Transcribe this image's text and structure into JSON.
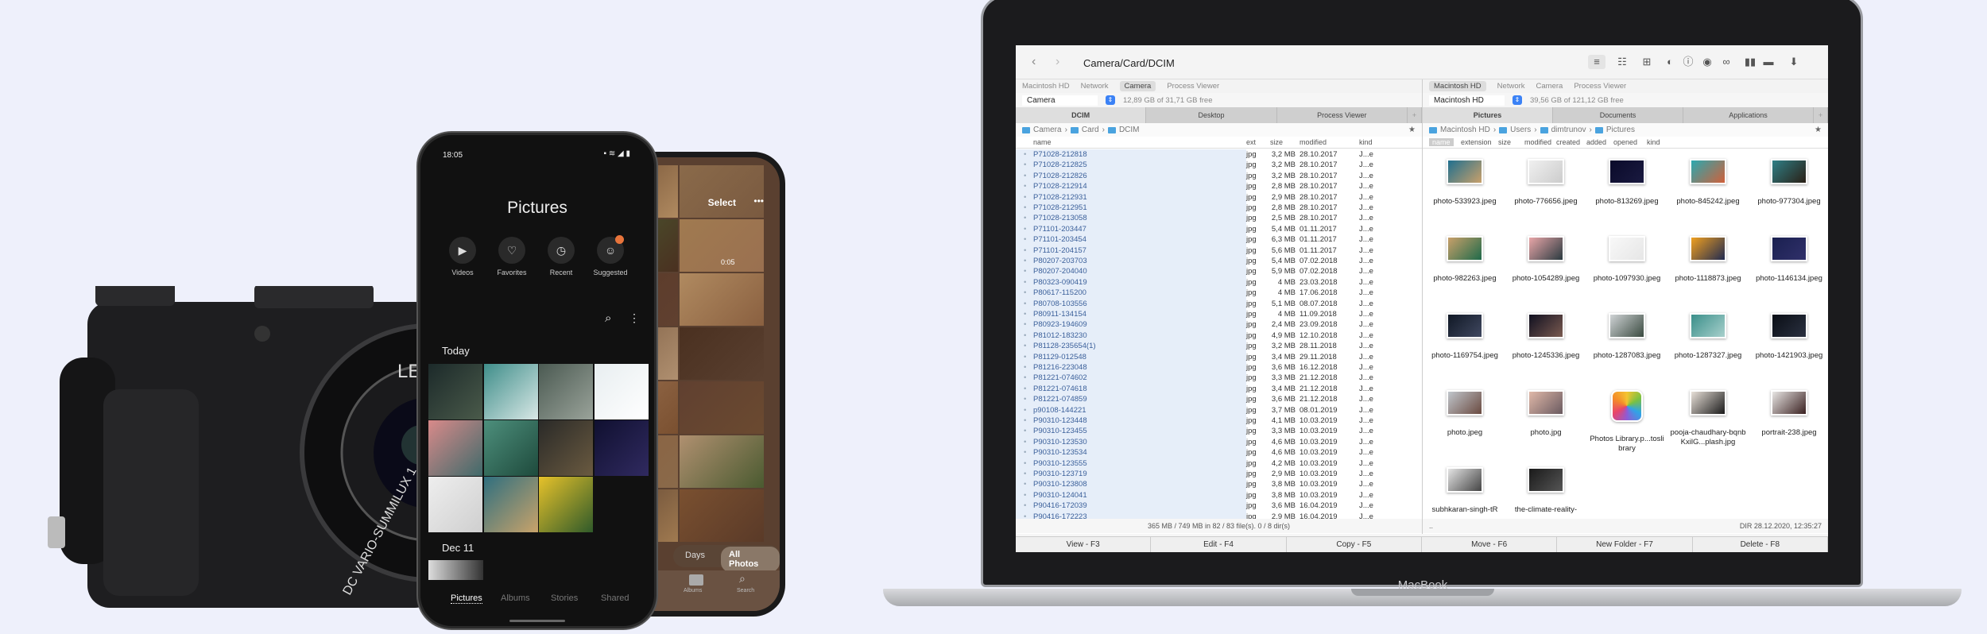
{
  "camera": {
    "brand_text": "LEI",
    "lens_text": "DC VARIO-SUMMILUX 1"
  },
  "android": {
    "time": "18:05",
    "title": "Pictures",
    "quick": [
      {
        "label": "Videos",
        "icon": "video-icon",
        "glyph": "▶"
      },
      {
        "label": "Favorites",
        "icon": "heart-icon",
        "glyph": "♡"
      },
      {
        "label": "Recent",
        "icon": "clock-icon",
        "glyph": "◷"
      },
      {
        "label": "Suggested",
        "icon": "suggested-icon",
        "glyph": "☺"
      }
    ],
    "section_today": "Today",
    "section_dec": "Dec 11",
    "thumb_colors": [
      [
        "#1c2a2a",
        "#4a5a4a"
      ],
      [
        "#3f8e8a",
        "#d9e8e6"
      ],
      [
        "#4b5a52",
        "#9aa39a"
      ],
      [
        "#e8eef0",
        "#ffffff"
      ],
      [
        "#d98a8a",
        "#3f6a6a"
      ],
      [
        "#4d8f7c",
        "#1e4a3c"
      ],
      [
        "#2a2a28",
        "#6a5a40"
      ],
      [
        "#101030",
        "#302a60"
      ],
      [
        "#eeeeee",
        "#cfcfcf"
      ],
      [
        "#2f6f7f",
        "#c9a36a"
      ],
      [
        "#e7c22a",
        "#2f5a2a"
      ]
    ],
    "nav": [
      {
        "label": "Pictures",
        "active": true
      },
      {
        "label": "Albums"
      },
      {
        "label": "Stories"
      },
      {
        "label": "Shared"
      }
    ]
  },
  "iphone": {
    "select": "Select",
    "more": "•••",
    "video_duration": "0:05",
    "days": "Days",
    "all_photos": "All Photos",
    "albums": "Albums",
    "search": "Search"
  },
  "laptop": {
    "brand": "MacBook"
  },
  "fm": {
    "path": "Camera/Card/DCIM",
    "locations": [
      "Macintosh HD",
      "Network",
      "Camera",
      "Process Viewer"
    ],
    "left": {
      "selected_location": "Camera",
      "volume": "Camera",
      "free": "12,89 GB of 31,71 GB free",
      "tabs": [
        "DCIM",
        "Desktop",
        "Process Viewer"
      ],
      "breadcrumb": [
        "Camera",
        "Card",
        "DCIM"
      ],
      "columns": [
        "name",
        "ext",
        "size",
        "modified",
        "kind"
      ],
      "files": [
        [
          "P71028-212818",
          "jpg",
          "3,2 MB",
          "28.10.2017",
          "J...e"
        ],
        [
          "P71028-212825",
          "jpg",
          "3,2 MB",
          "28.10.2017",
          "J...e"
        ],
        [
          "P71028-212826",
          "jpg",
          "3,2 MB",
          "28.10.2017",
          "J...e"
        ],
        [
          "P71028-212914",
          "jpg",
          "2,8 MB",
          "28.10.2017",
          "J...e"
        ],
        [
          "P71028-212931",
          "jpg",
          "2,9 MB",
          "28.10.2017",
          "J...e"
        ],
        [
          "P71028-212951",
          "jpg",
          "2,8 MB",
          "28.10.2017",
          "J...e"
        ],
        [
          "P71028-213058",
          "jpg",
          "2,5 MB",
          "28.10.2017",
          "J...e"
        ],
        [
          "P71101-203447",
          "jpg",
          "5,4 MB",
          "01.11.2017",
          "J...e"
        ],
        [
          "P71101-203454",
          "jpg",
          "6,3 MB",
          "01.11.2017",
          "J...e"
        ],
        [
          "P71101-204157",
          "jpg",
          "5,6 MB",
          "01.11.2017",
          "J...e"
        ],
        [
          "P80207-203703",
          "jpg",
          "5,4 MB",
          "07.02.2018",
          "J...e"
        ],
        [
          "P80207-204040",
          "jpg",
          "5,9 MB",
          "07.02.2018",
          "J...e"
        ],
        [
          "P80323-090419",
          "jpg",
          "4 MB",
          "23.03.2018",
          "J...e"
        ],
        [
          "P80617-115200",
          "jpg",
          "4 MB",
          "17.06.2018",
          "J...e"
        ],
        [
          "P80708-103556",
          "jpg",
          "5,1 MB",
          "08.07.2018",
          "J...e"
        ],
        [
          "P80911-134154",
          "jpg",
          "4 MB",
          "11.09.2018",
          "J...e"
        ],
        [
          "P80923-194609",
          "jpg",
          "2,4 MB",
          "23.09.2018",
          "J...e"
        ],
        [
          "P81012-183230",
          "jpg",
          "4,9 MB",
          "12.10.2018",
          "J...e"
        ],
        [
          "P81128-235654(1)",
          "jpg",
          "3,2 MB",
          "28.11.2018",
          "J...e"
        ],
        [
          "P81129-012548",
          "jpg",
          "3,4 MB",
          "29.11.2018",
          "J...e"
        ],
        [
          "P81216-223048",
          "jpg",
          "3,6 MB",
          "16.12.2018",
          "J...e"
        ],
        [
          "P81221-074602",
          "jpg",
          "3,3 MB",
          "21.12.2018",
          "J...e"
        ],
        [
          "P81221-074618",
          "jpg",
          "3,4 MB",
          "21.12.2018",
          "J...e"
        ],
        [
          "P81221-074859",
          "jpg",
          "3,6 MB",
          "21.12.2018",
          "J...e"
        ],
        [
          "p90108-144221",
          "jpg",
          "3,7 MB",
          "08.01.2019",
          "J...e"
        ],
        [
          "P90310-123448",
          "jpg",
          "4,1 MB",
          "10.03.2019",
          "J...e"
        ],
        [
          "P90310-123455",
          "jpg",
          "3,3 MB",
          "10.03.2019",
          "J...e"
        ],
        [
          "P90310-123530",
          "jpg",
          "4,6 MB",
          "10.03.2019",
          "J...e"
        ],
        [
          "P90310-123534",
          "jpg",
          "4,6 MB",
          "10.03.2019",
          "J...e"
        ],
        [
          "P90310-123555",
          "jpg",
          "4,2 MB",
          "10.03.2019",
          "J...e"
        ],
        [
          "P90310-123719",
          "jpg",
          "2,9 MB",
          "10.03.2019",
          "J...e"
        ],
        [
          "P90310-123808",
          "jpg",
          "3,8 MB",
          "10.03.2019",
          "J...e"
        ],
        [
          "P90310-124041",
          "jpg",
          "3,8 MB",
          "10.03.2019",
          "J...e"
        ],
        [
          "P90416-172039",
          "jpg",
          "3,6 MB",
          "16.04.2019",
          "J...e"
        ],
        [
          "P90416-172223",
          "jpg",
          "2,9 MB",
          "16.04.2019",
          "J...e"
        ]
      ],
      "summary": "365 MB / 749 MB in 82 / 83 file(s). 0 / 8 dir(s)"
    },
    "right": {
      "selected_location": "Macintosh HD",
      "volume": "Macintosh HD",
      "free": "39,56 GB of 121,12 GB free",
      "tabs": [
        "Pictures",
        "Documents",
        "Applications"
      ],
      "breadcrumb": [
        "Macintosh HD",
        "Users",
        "dimtrunov",
        "Pictures"
      ],
      "columns": [
        "name",
        "extension",
        "size",
        "modified",
        "created",
        "added",
        "opened",
        "kind"
      ],
      "items": [
        {
          "name": "photo-533923.jpeg",
          "c": [
            "#1f6f8f",
            "#c9a06a"
          ]
        },
        {
          "name": "photo-776656.jpeg",
          "c": [
            "#f0f0f0",
            "#cccccc"
          ]
        },
        {
          "name": "photo-813269.jpeg",
          "c": [
            "#0a0a2a",
            "#1a1a40"
          ]
        },
        {
          "name": "photo-845242.jpeg",
          "c": [
            "#2aa8b0",
            "#d0603a"
          ]
        },
        {
          "name": "photo-977304.jpeg",
          "c": [
            "#2f7f86",
            "#2a1f15"
          ]
        },
        {
          "name": "photo-982263.jpeg",
          "c": [
            "#c9a06a",
            "#1f6a4a"
          ]
        },
        {
          "name": "photo-1054289.jpeg",
          "c": [
            "#e9a6a8",
            "#2a3a40"
          ]
        },
        {
          "name": "photo-1097930.jpeg",
          "c": [
            "#f8f8f8",
            "#e6e6e6"
          ]
        },
        {
          "name": "photo-1118873.jpeg",
          "c": [
            "#f0a020",
            "#202a50"
          ]
        },
        {
          "name": "photo-1146134.jpeg",
          "c": [
            "#1a2050",
            "#30306a"
          ]
        },
        {
          "name": "photo-1169754.jpeg",
          "c": [
            "#101825",
            "#404860"
          ]
        },
        {
          "name": "photo-1245336.jpeg",
          "c": [
            "#101020",
            "#7a5a50"
          ]
        },
        {
          "name": "photo-1287083.jpeg",
          "c": [
            "#d0d4d6",
            "#3a4a40"
          ]
        },
        {
          "name": "photo-1287327.jpeg",
          "c": [
            "#3a8f8a",
            "#a8d0cc"
          ]
        },
        {
          "name": "photo-1421903.jpeg",
          "c": [
            "#0a0e15",
            "#2a3040"
          ]
        },
        {
          "name": "photo.jpeg",
          "c": [
            "#c0c6cc",
            "#6a4a40"
          ]
        },
        {
          "name": "photo.jpg",
          "c": [
            "#e0b8a8",
            "#6a5a60"
          ]
        },
        {
          "name": "Photos Library.p...toslibrary",
          "c": [
            "#ffffff",
            "#eeeeee"
          ],
          "photos": true
        },
        {
          "name": "pooja-chaudhary-bqnbKxilG...plash.jpg",
          "c": [
            "#e8e0d8",
            "#1a1a1a"
          ]
        },
        {
          "name": "portrait-238.jpeg",
          "c": [
            "#e8e6e4",
            "#3a2020"
          ]
        },
        {
          "name": "subhkaran-singh-tR",
          "c": [
            "#e4e4e4",
            "#444444"
          ]
        },
        {
          "name": "the-climate-reality-",
          "c": [
            "#1a1a1a",
            "#555555"
          ]
        }
      ],
      "status_left": "..",
      "status_right": "DIR   28.12.2020, 12:35:27"
    },
    "footer": [
      "View - F3",
      "Edit - F4",
      "Copy - F5",
      "Move - F6",
      "New Folder - F7",
      "Delete - F8"
    ]
  }
}
